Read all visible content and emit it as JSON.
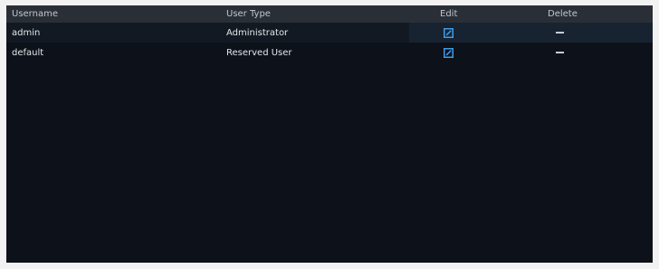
{
  "table": {
    "columns": {
      "username": "Username",
      "user_type": "User Type",
      "edit": "Edit",
      "delete": "Delete"
    },
    "rows": [
      {
        "username": "admin",
        "user_type": "Administrator",
        "edit_icon": "edit-icon",
        "delete_icon": "dash-icon"
      },
      {
        "username": "default",
        "user_type": "Reserved User",
        "edit_icon": "edit-icon",
        "delete_icon": "dash-icon"
      }
    ]
  },
  "colors": {
    "background": "#0d1119",
    "header": "#2a2f37",
    "accent": "#3d9be9"
  }
}
